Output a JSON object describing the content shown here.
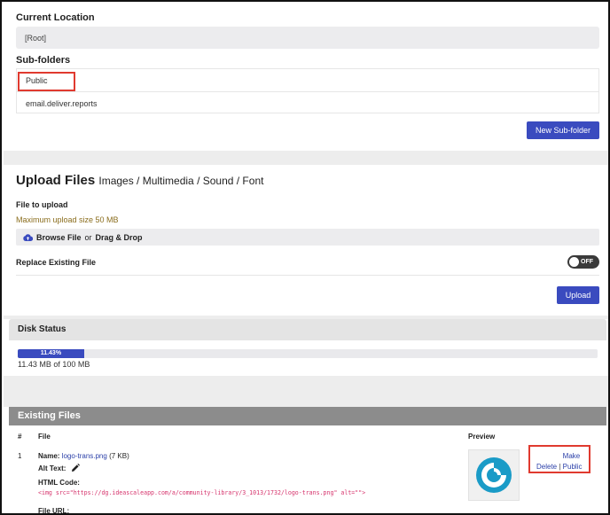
{
  "location": {
    "heading": "Current Location",
    "path": "[Root]"
  },
  "subfolders": {
    "heading": "Sub-folders",
    "items": [
      "Public",
      "email.deliver.reports"
    ],
    "new_button": "New Sub-folder"
  },
  "upload": {
    "title": "Upload Files",
    "types": "Images / Multimedia / Sound / Font",
    "file_label": "File to upload",
    "max_size": "Maximum upload size 50 MB",
    "browse": "Browse File",
    "or": "or",
    "drag_drop": "Drag & Drop",
    "replace_label": "Replace Existing File",
    "toggle_state": "OFF",
    "upload_button": "Upload"
  },
  "disk": {
    "heading": "Disk Status",
    "percent_label": "11.43%",
    "fraction_used": 0.1143,
    "usage_text": "11.43 MB of 100 MB"
  },
  "files": {
    "heading": "Existing Files",
    "columns": {
      "num": "#",
      "file": "File",
      "preview": "Preview"
    },
    "rows": [
      {
        "num": "1",
        "name_label": "Name:",
        "name": "logo-trans.png",
        "size": "(7 KB)",
        "alt_label": "Alt Text:",
        "code_label": "HTML Code:",
        "snippet": "<img src=\"https://dg.ideascaleapp.com/a/community-library/3_1013/1732/logo-trans.png\" alt=\"\">",
        "url_label": "File URL:",
        "actions": {
          "delete": "Delete",
          "sep": "|",
          "make_public": "Make Public"
        }
      }
    ]
  },
  "colors": {
    "accent": "#3a4bbf",
    "highlight": "#e03a2f",
    "logo": "#1a9bc7"
  }
}
